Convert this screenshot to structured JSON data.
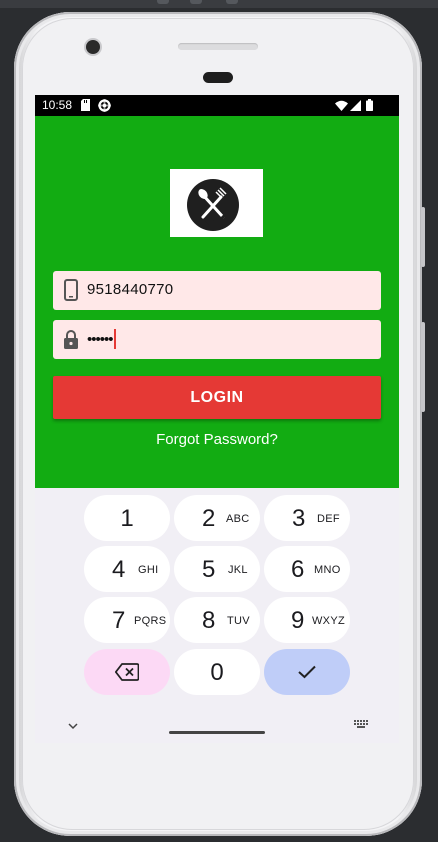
{
  "status_bar": {
    "time": "10:58",
    "icons_left": [
      "sd-card-icon",
      "settings-gear-icon"
    ],
    "icons_right": [
      "wifi-icon",
      "cell-signal-icon",
      "battery-icon"
    ]
  },
  "app": {
    "background_color": "#12ac12",
    "logo_icon": "fork-spoon-logo-icon",
    "phone_field": {
      "icon": "phone-icon",
      "value": "9518440770"
    },
    "password_field": {
      "icon": "lock-icon",
      "value": "••••••"
    },
    "login_label": "LOGIN",
    "forgot_label": "Forgot Password?",
    "accent_color": "#e53935",
    "field_bg": "#ffe8e8"
  },
  "keypad": {
    "keys": [
      {
        "digit": "1",
        "letters": ""
      },
      {
        "digit": "2",
        "letters": "ABC"
      },
      {
        "digit": "3",
        "letters": "DEF"
      },
      {
        "digit": "4",
        "letters": "GHI"
      },
      {
        "digit": "5",
        "letters": "JKL"
      },
      {
        "digit": "6",
        "letters": "MNO"
      },
      {
        "digit": "7",
        "letters": "PQRS"
      },
      {
        "digit": "8",
        "letters": "TUV"
      },
      {
        "digit": "9",
        "letters": "WXYZ"
      },
      {
        "digit": "0",
        "letters": ""
      }
    ],
    "backspace_icon": "backspace-icon",
    "done_icon": "check-icon",
    "hide_icon": "chevron-down-icon",
    "switch_icon": "keyboard-icon"
  }
}
